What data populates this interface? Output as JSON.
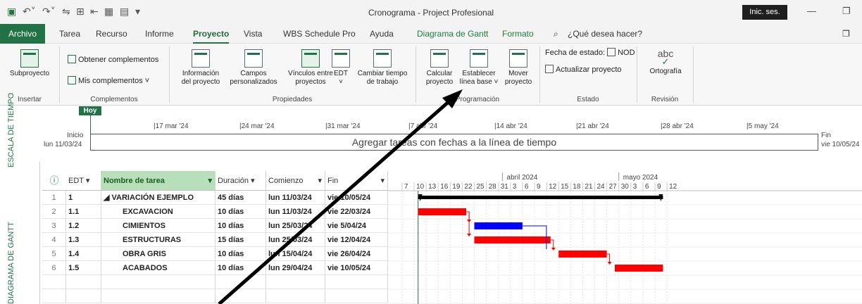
{
  "app": {
    "title": "Cronograma - Project Profesional",
    "sign_in": "Inic. ses."
  },
  "tabs": [
    "Archivo",
    "Tarea",
    "Recurso",
    "Informe",
    "Proyecto",
    "Vista",
    "WBS Schedule Pro",
    "Ayuda",
    "Diagrama de Gantt",
    "Formato"
  ],
  "search": "¿Qué desea hacer?",
  "ribbon": {
    "insertar": {
      "btn": "Subproyecto",
      "label": "Insertar"
    },
    "complementos": {
      "obtener": "Obtener complementos",
      "mis": "Mis complementos",
      "label": "Complementos"
    },
    "propiedades": {
      "info1": "Información",
      "info2": "del proyecto",
      "campos1": "Campos",
      "campos2": "personalizados",
      "vinc1": "Vínculos entre",
      "vinc2": "proyectos",
      "edt": "EDT",
      "cambiar1": "Cambiar tiempo",
      "cambiar2": "de trabajo",
      "label": "Propiedades"
    },
    "programacion": {
      "calc1": "Calcular",
      "calc2": "proyecto",
      "est1": "Establecer",
      "est2": "línea base",
      "mover1": "Mover",
      "mover2": "proyecto",
      "label": "Programación"
    },
    "estado": {
      "fecha": "Fecha de estado:",
      "fecha_val": "NOD",
      "actualizar": "Actualizar proyecto",
      "label": "Estado"
    },
    "revision": {
      "orto": "Ortografía",
      "abc": "abc",
      "label": "Revisión"
    }
  },
  "timeline": {
    "side_label": "ESCALA DE TIEMPO",
    "today": "Hoy",
    "start_label": "Inicio",
    "start_date": "lun 11/03/24",
    "end_label": "Fin",
    "end_date": "vie 10/05/24",
    "placeholder": "Agregar tareas con fechas a la línea de tiempo",
    "ticks": [
      "17 mar '24",
      "24 mar '24",
      "31 mar '24",
      "7 abr '24",
      "14 abr '24",
      "21 abr '24",
      "28 abr '24",
      "5 may '24"
    ]
  },
  "gantt_label": "DIAGRAMA DE GANTT",
  "columns": {
    "edt": "EDT",
    "nombre": "Nombre de tarea",
    "duracion": "Duración",
    "comienzo": "Comienzo",
    "fin": "Fin"
  },
  "tasks": [
    {
      "id": "1",
      "edt": "1",
      "name": "◢ VARIACIÓN EJEMPLO",
      "dur": "45 días",
      "start": "lun 11/03/24",
      "end": "vie 10/05/24",
      "summary": true
    },
    {
      "id": "2",
      "edt": "1.1",
      "name": "EXCAVACION",
      "dur": "10 días",
      "start": "lun 11/03/24",
      "end": "vie 22/03/24",
      "summary": false
    },
    {
      "id": "3",
      "edt": "1.2",
      "name": "CIMIENTOS",
      "dur": "10 días",
      "start": "lun 25/03/24",
      "end": "vie 5/04/24",
      "summary": false
    },
    {
      "id": "4",
      "edt": "1.3",
      "name": "ESTRUCTURAS",
      "dur": "15 días",
      "start": "lun 25/03/24",
      "end": "vie 12/04/24",
      "summary": false
    },
    {
      "id": "5",
      "edt": "1.4",
      "name": "OBRA GRIS",
      "dur": "10 días",
      "start": "lun 15/04/24",
      "end": "vie 26/04/24",
      "summary": false
    },
    {
      "id": "6",
      "edt": "1.5",
      "name": "ACABADOS",
      "dur": "10 días",
      "start": "lun 29/04/24",
      "end": "vie 10/05/24",
      "summary": false
    }
  ],
  "chart_header": {
    "months": [
      "abril 2024",
      "mayo 2024"
    ],
    "days": [
      "7",
      "10",
      "13",
      "16",
      "19",
      "22",
      "25",
      "28",
      "31",
      "3",
      "6",
      "9",
      "12",
      "15",
      "18",
      "21",
      "24",
      "27",
      "30",
      "3",
      "6",
      "9",
      "12"
    ]
  },
  "colors": {
    "accent": "#217346",
    "critical": "#ff0000",
    "noncritical": "#0000ff",
    "summary": "#000000"
  }
}
